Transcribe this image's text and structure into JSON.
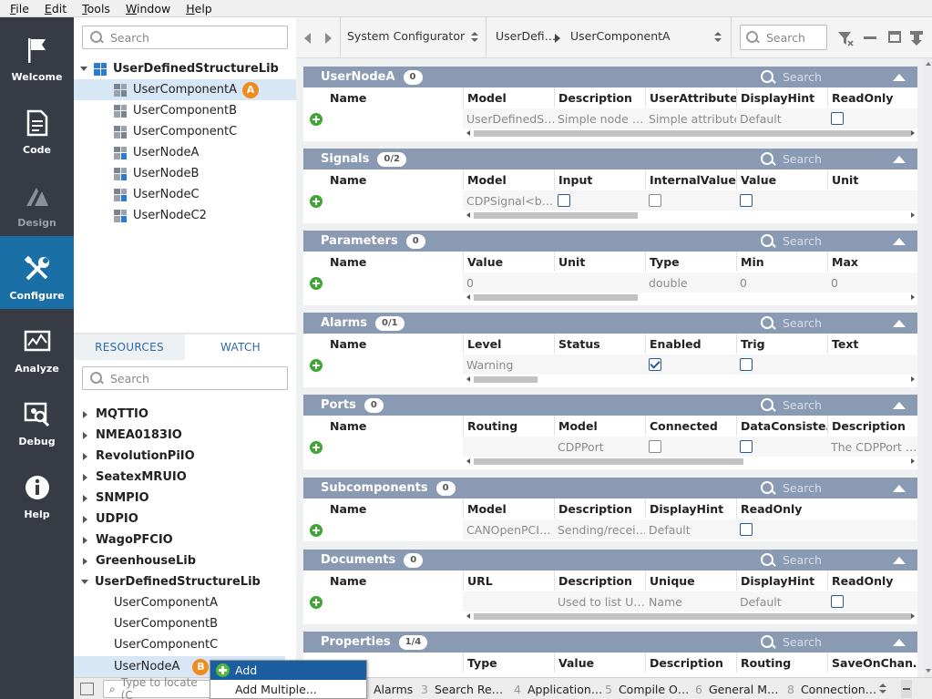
{
  "menu": [
    "File",
    "Edit",
    "Tools",
    "Window",
    "Help"
  ],
  "nav": [
    {
      "label": "Welcome"
    },
    {
      "label": "Code"
    },
    {
      "label": "Design"
    },
    {
      "label": "Configure"
    },
    {
      "label": "Analyze"
    },
    {
      "label": "Debug"
    },
    {
      "label": "Help"
    }
  ],
  "tree": {
    "search_placeholder": "Search",
    "root": "UserDefinedStructureLib",
    "items": [
      "UserComponentA",
      "UserComponentB",
      "UserComponentC",
      "UserNodeA",
      "UserNodeB",
      "UserNodeC",
      "UserNodeC2"
    ],
    "badge": "A"
  },
  "resources": {
    "tabs": [
      "RESOURCES",
      "WATCH"
    ],
    "search_placeholder": "Search",
    "libs": [
      "MQTTIO",
      "NMEA0183IO",
      "RevolutionPiIO",
      "SeatexMRUIO",
      "SNMPIO",
      "UDPIO",
      "WagoPFCIO",
      "GreenhouseLib",
      "UserDefinedStructureLib"
    ],
    "children": [
      "UserComponentA",
      "UserComponentB",
      "UserComponentC",
      "UserNodeA"
    ],
    "badge": "B"
  },
  "context_menu": {
    "items": [
      "Add",
      "Add Multiple..."
    ]
  },
  "toolbar": {
    "combo1": "System Configurator",
    "crumb1": "UserDefi…",
    "crumb2": "UserComponentA",
    "search_placeholder": "Search"
  },
  "sections": [
    {
      "title": "UserNodeA",
      "count": "0",
      "search": "Search",
      "cols": [
        "Name",
        "Model",
        "Description",
        "UserAttribute",
        "DisplayHint",
        "ReadOnly"
      ],
      "row": [
        "UserDefinedS…",
        "Simple node …",
        "Simple attribute",
        "Default"
      ]
    },
    {
      "title": "Signals",
      "count": "0/2",
      "search": "Search",
      "cols": [
        "Name",
        "Model",
        "Input",
        "InternalValue",
        "Value",
        "Unit"
      ],
      "row": [
        "CDPSignal<b…"
      ]
    },
    {
      "title": "Parameters",
      "count": "0",
      "search": "Search",
      "cols": [
        "Name",
        "Value",
        "Unit",
        "Type",
        "Min",
        "Max"
      ],
      "row": [
        "0",
        "",
        "double",
        "0",
        "0"
      ]
    },
    {
      "title": "Alarms",
      "count": "0/1",
      "search": "Search",
      "cols": [
        "Name",
        "Level",
        "Status",
        "Enabled",
        "Trig",
        "Text"
      ],
      "row": [
        "Warning"
      ]
    },
    {
      "title": "Ports",
      "count": "0",
      "search": "Search",
      "cols": [
        "Name",
        "Routing",
        "Model",
        "Connected",
        "DataConsiste…",
        "Description"
      ],
      "row": [
        "CDPPort",
        "The CDPPort …"
      ]
    },
    {
      "title": "Subcomponents",
      "count": "0",
      "search": "Search",
      "cols": [
        "Name",
        "Model",
        "Description",
        "DisplayHint",
        "ReadOnly"
      ],
      "row": [
        "CANOpenPCI…",
        "Sending/recei…",
        "Default"
      ]
    },
    {
      "title": "Documents",
      "count": "0",
      "search": "Search",
      "cols": [
        "Name",
        "URL",
        "Description",
        "Unique",
        "DisplayHint",
        "ReadOnly"
      ],
      "row": [
        "Used to list U…",
        "Name",
        "Default"
      ]
    },
    {
      "title": "Properties",
      "count": "1/4",
      "search": "Search",
      "cols": [
        "Type",
        "Value",
        "Description",
        "Routing",
        "SaveOnChan…"
      ]
    }
  ],
  "statusbar": {
    "locate_placeholder": "Type to locate (C",
    "tabs": [
      {
        "n": "",
        "label": "Alarms"
      },
      {
        "n": "3",
        "label": "Search Re…"
      },
      {
        "n": "4",
        "label": "Application…"
      },
      {
        "n": "5",
        "label": "Compile O…"
      },
      {
        "n": "6",
        "label": "General M…"
      },
      {
        "n": "8",
        "label": "Connection…"
      }
    ]
  }
}
